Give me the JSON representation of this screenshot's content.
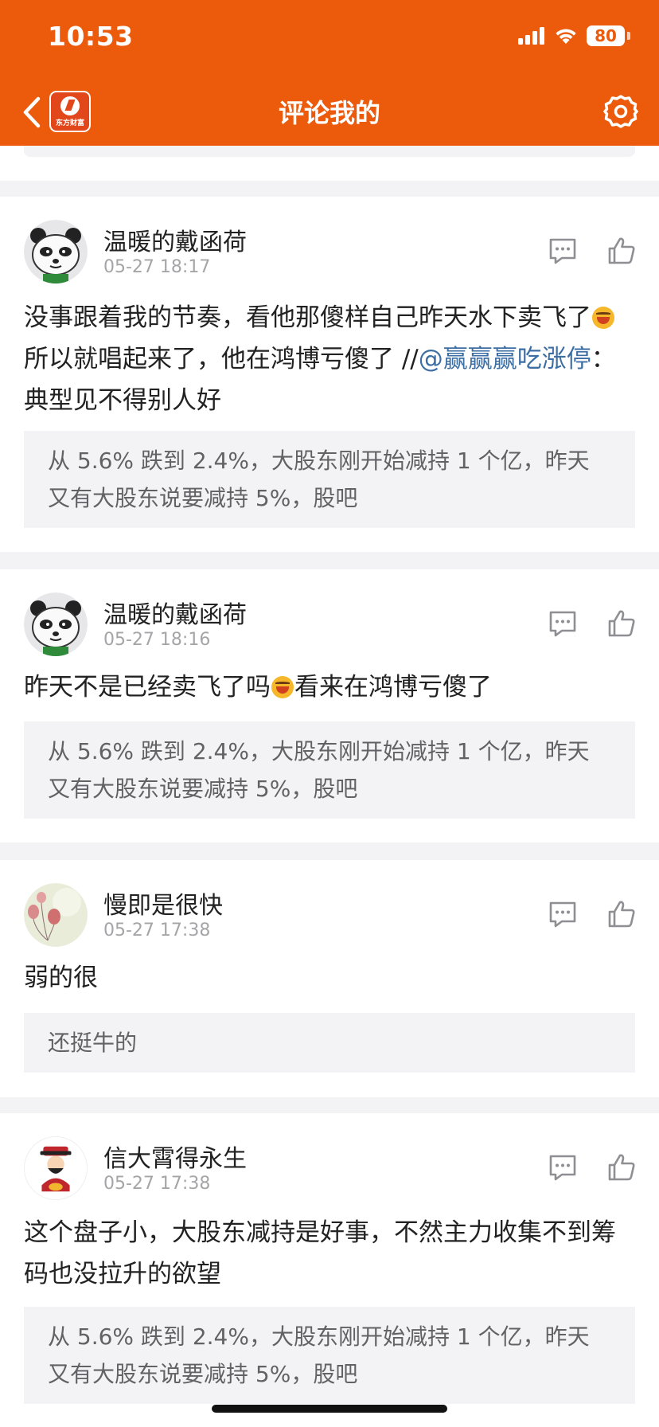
{
  "status_bar": {
    "time": "10:53",
    "battery": "80"
  },
  "header": {
    "title": "评论我的",
    "logo_text": "东方财富"
  },
  "comments": [
    {
      "username": "温暖的戴函荷",
      "time": "05-27 18:17",
      "text_part1": "没事跟着我的节奏，看他那傻样自己昨天水下卖飞了",
      "text_part2": "所以就唱起来了，他在鸿博亏傻了 //",
      "mention": "@赢赢赢吃涨停",
      "text_part3": "：典型见不得别人好",
      "quote": "从 5.6% 跌到 2.4%，大股东刚开始减持 1 个亿，昨天又有大股东说要减持 5%，股吧"
    },
    {
      "username": "温暖的戴函荷",
      "time": "05-27 18:16",
      "text_part1": "昨天不是已经卖飞了吗",
      "text_part2": "看来在鸿博亏傻了",
      "quote": "从 5.6% 跌到 2.4%，大股东刚开始减持 1 个亿，昨天又有大股东说要减持 5%，股吧"
    },
    {
      "username": "慢即是很快",
      "time": "05-27 17:38",
      "text": "弱的很",
      "quote": "还挺牛的"
    },
    {
      "username": "信大霄得永生",
      "time": "05-27 17:38",
      "text": "这个盘子小，大股东减持是好事，不然主力收集不到筹码也没拉升的欲望",
      "quote": "从 5.6% 跌到 2.4%，大股东刚开始减持 1 个亿，昨天又有大股东说要减持 5%，股吧"
    }
  ],
  "icons": {
    "back": "chevron-left-icon",
    "settings": "gear-icon",
    "reply": "comment-icon",
    "like": "thumbs-up-icon"
  },
  "colors": {
    "brand": "#ec5a0b",
    "mention": "#3d6ea3"
  }
}
